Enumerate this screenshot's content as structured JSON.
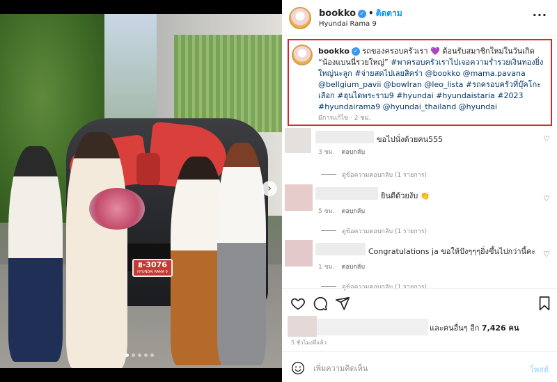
{
  "post": {
    "username": "bookko",
    "follow_label": "ติดตาม",
    "separator": "•",
    "location": "Hyundai Rama 9",
    "more_label": "···"
  },
  "photo": {
    "plate_number": "ฮ-3076",
    "plate_sub": "HYUNDAI RAMA 9",
    "next_label": "›"
  },
  "caption": {
    "username": "bookko",
    "text_1": "รถของครอบครัวเรา 💜  ต้อนรับสมาชิกใหม่ในวันเกิด “น้องแบนนี่รวยใหญ่” ",
    "tags_1": "#พาครอบครัวเราไปเจอความร่ำรวยเงินทองยิ่งใหญ่นะลูก #จ่ายสดไปเลยสิคร่า @bookko @mama.pavana @bellgium_pavii @bowlran @leo_lista #รถครอบครัวที่บุ๊คโกะเลือก #ฮุนไดพระราม9 #hyundai #hyundaistaria #2023 #hyundairama9 @hyundai_thailand @hyundai",
    "time": "มีการแก้ไข · 2 ชม."
  },
  "comments": [
    {
      "text": "ขอไปนั่งด้วยคน555",
      "time": "3 ชม.",
      "reply": "ตอบกลับ",
      "view_replies": "ดูข้อความตอบกลับ (1 รายการ)"
    },
    {
      "text": "ยินดีด้วยงับ 👏",
      "time": "5 ชม.",
      "reply": "ตอบกลับ",
      "view_replies": "ดูข้อความตอบกลับ (1 รายการ)"
    },
    {
      "text": "Congratulations ja ขอให้ปังๆๆๆยิ่งขึ้นไปกว่านี้คะ",
      "time": "1 ชม.",
      "reply": "ตอบกลับ",
      "view_replies": "ดูข้อความตอบกลับ (1 รายการ)"
    }
  ],
  "likes": {
    "text": "และคนอื่นๆ อีก ",
    "count": "7,426 คน"
  },
  "posted_ago": "5 ชั่วโมงที่แล้ว",
  "composer": {
    "placeholder": "เพิ่มความคิดเห็น",
    "post_label": "โพสต์"
  },
  "icons": [
    "heart-icon",
    "comment-icon",
    "share-icon",
    "bookmark-icon",
    "emoji-icon",
    "verified-icon"
  ],
  "colors": {
    "link": "#0095f6",
    "tag": "#00376b",
    "highlight_border": "#d7262b"
  }
}
